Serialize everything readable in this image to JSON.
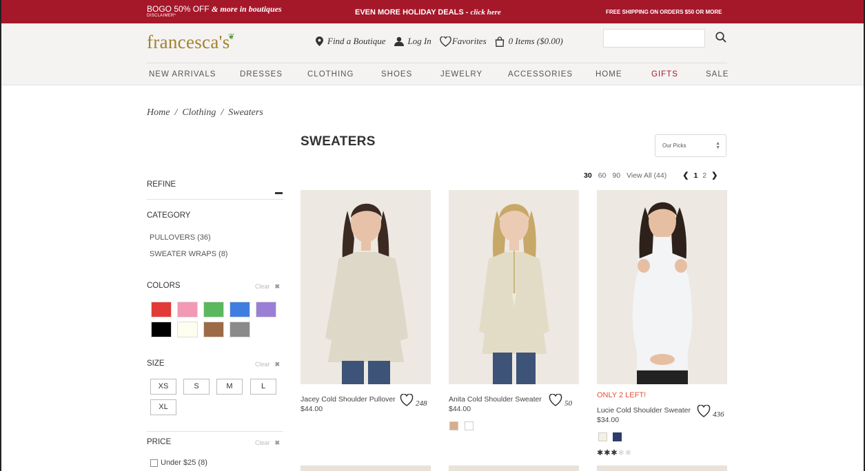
{
  "promo": {
    "left_main": "BOGO 50% OFF",
    "left_italic": "& more in boutiques",
    "left_small": "DISCLAIMER*",
    "mid_main": "EVEN MORE HOLIDAY DEALS - ",
    "mid_italic": "click here",
    "right": "FREE SHIPPING ON ORDERS $50 OR MORE",
    "bg_color": "#a5182a"
  },
  "header": {
    "logo": "francesca's",
    "find_boutique": "Find a Boutique",
    "login": "Log In",
    "favorites": "Favorites",
    "cart": "0 Items ($0.00)",
    "search_placeholder": ""
  },
  "nav": [
    "NEW ARRIVALS",
    "DRESSES",
    "CLOTHING",
    "SHOES",
    "JEWELRY",
    "ACCESSORIES",
    "HOME",
    "GIFTS",
    "SALE"
  ],
  "breadcrumb": [
    "Home",
    "Clothing",
    "Sweaters"
  ],
  "page_title": "SWEATERS",
  "sort": {
    "selected": "Our Picks"
  },
  "pager": {
    "per_page": [
      "30",
      "60",
      "90"
    ],
    "view_all": "View All (44)",
    "pages": [
      "1",
      "2"
    ],
    "prev": "<",
    "next": ">"
  },
  "sidebar": {
    "refine": "REFINE",
    "category_title": "CATEGORY",
    "categories": [
      "PULLOVERS (36)",
      "SWEATER WRAPS (8)"
    ],
    "colors_title": "COLORS",
    "clear": "Clear",
    "colors": [
      "#e23a36",
      "#f29ab5",
      "#5cb85c",
      "#3f7ee0",
      "#9b7fd4",
      "#000000",
      "#fdfdf0",
      "#9c6b45",
      "#8a8a8a"
    ],
    "size_title": "SIZE",
    "sizes": [
      "XS",
      "S",
      "M",
      "L",
      "XL"
    ],
    "price_title": "PRICE",
    "price_options": [
      "Under $25 (8)"
    ]
  },
  "products": [
    {
      "name": "Jacey Cold Shoulder Pullover",
      "price": "$44.00",
      "favorites": "248",
      "swatches": []
    },
    {
      "name": "Anita Cold Shoulder Sweater",
      "price": "$44.00",
      "favorites": "50",
      "swatches": [
        "#d9ad8c",
        "#ffffff"
      ]
    },
    {
      "name": "Lucie Cold Shoulder Sweater",
      "price": "$34.00",
      "favorites": "436",
      "badge": "ONLY 2 LEFT!",
      "swatches": [
        "#f5f1e0",
        "#2e3b6b"
      ],
      "rating": 3,
      "rating_max": 5
    }
  ],
  "rating_display": {
    "on": "✱✱✱",
    "off": "✱✱"
  }
}
